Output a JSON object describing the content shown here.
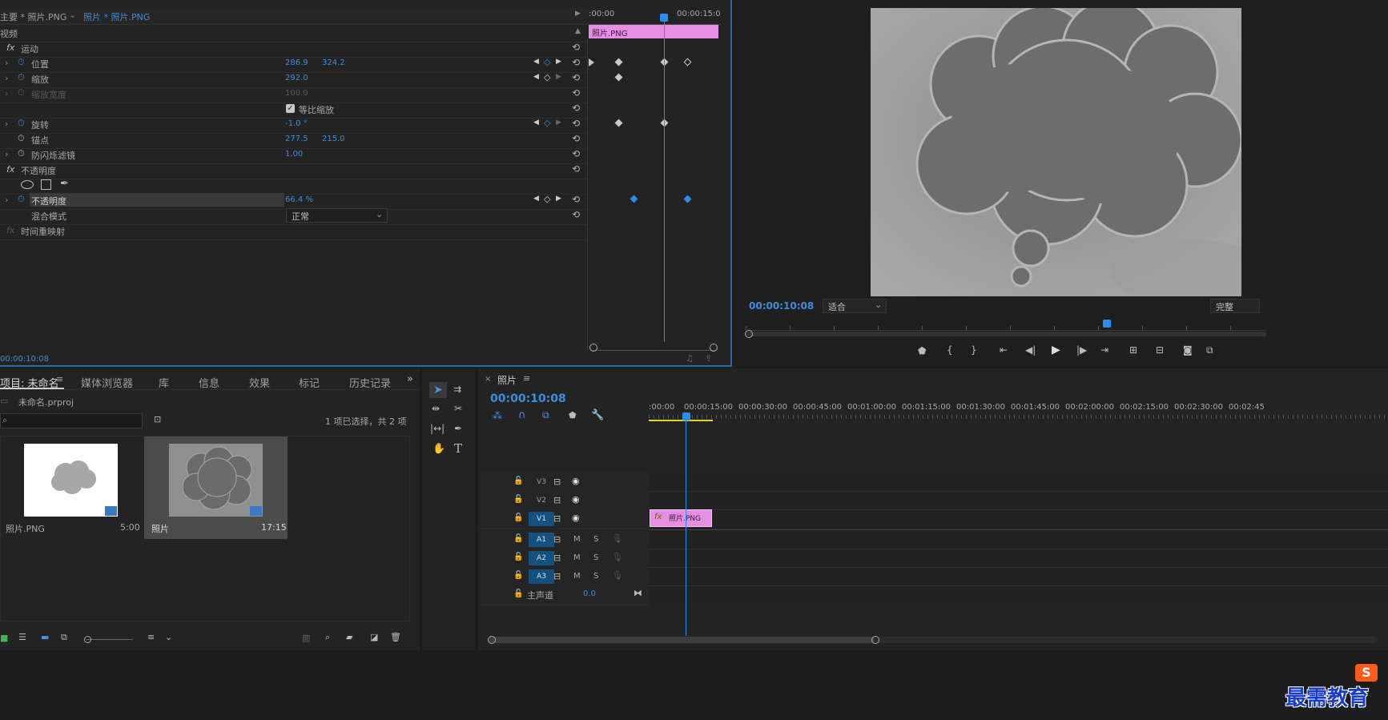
{
  "effect_controls": {
    "master_tab": "主要 * 照片.PNG",
    "clip_tab": "照片 * 照片.PNG",
    "section_video": "视频",
    "ruler_start": ":00:00",
    "ruler_end": "00:00:15:0",
    "clip_bar_label": "照片.PNG",
    "motion": {
      "fx_label": "fx",
      "name": "运动",
      "position": {
        "label": "位置",
        "x": "286.9",
        "y": "324.2"
      },
      "scale": {
        "label": "缩放",
        "value": "292.0"
      },
      "scale_width": {
        "label": "缩放宽度",
        "value": "100.0"
      },
      "uniform_scale": {
        "label": "等比缩放",
        "checked": true
      },
      "rotation": {
        "label": "旋转",
        "value": "-1.0 °"
      },
      "anchor": {
        "label": "锚点",
        "x": "277.5",
        "y": "215.0"
      },
      "antiflicker": {
        "label": "防闪烁滤镜",
        "value": "1.00"
      }
    },
    "opacity": {
      "fx_label": "fx",
      "name": "不透明度",
      "param_label": "不透明度",
      "value": "66.4 %",
      "blend_label": "混合模式",
      "blend_value": "正常"
    },
    "time_remap": {
      "fx_label": "fx",
      "name": "时间重映射"
    },
    "current_time": "00:00:10:08"
  },
  "program_monitor": {
    "timecode": "00:00:10:08",
    "fit_select": "适合",
    "quality_select": "完整"
  },
  "project_panel": {
    "tabs": [
      "项目: 未命名",
      "媒体浏览器",
      "库",
      "信息",
      "效果",
      "标记",
      "历史记录"
    ],
    "project_file": "未命名.prproj",
    "search_placeholder": "",
    "selection_info": "1 项已选择，共 2 项",
    "items": [
      {
        "name": "照片.PNG",
        "duration": "5:00"
      },
      {
        "name": "照片",
        "duration": "17:15"
      }
    ]
  },
  "sequence": {
    "tab_name": "照片",
    "timecode": "00:00:10:08",
    "ruler_labels": [
      ":00:00",
      "00:00:15:00",
      "00:00:30:00",
      "00:00:45:00",
      "00:01:00:00",
      "00:01:15:00",
      "00:01:30:00",
      "00:01:45:00",
      "00:02:00:00",
      "00:02:15:00",
      "00:02:30:00",
      "00:02:45"
    ],
    "video_tracks": [
      "V3",
      "V2",
      "V1"
    ],
    "audio_tracks": [
      "A1",
      "A2",
      "A3"
    ],
    "master_label": "主声道",
    "master_value": "0.0",
    "track_m": "M",
    "track_s": "S",
    "clip_label": "照片.PNG",
    "clip_fx": "fx"
  },
  "watermark": {
    "text": "最需教育",
    "badge": "S"
  },
  "colors": {
    "accent_blue": "#2c8cf0",
    "clip_pink": "#e58ee3",
    "panel_bg": "#232323",
    "track_selected": "#14517e"
  }
}
